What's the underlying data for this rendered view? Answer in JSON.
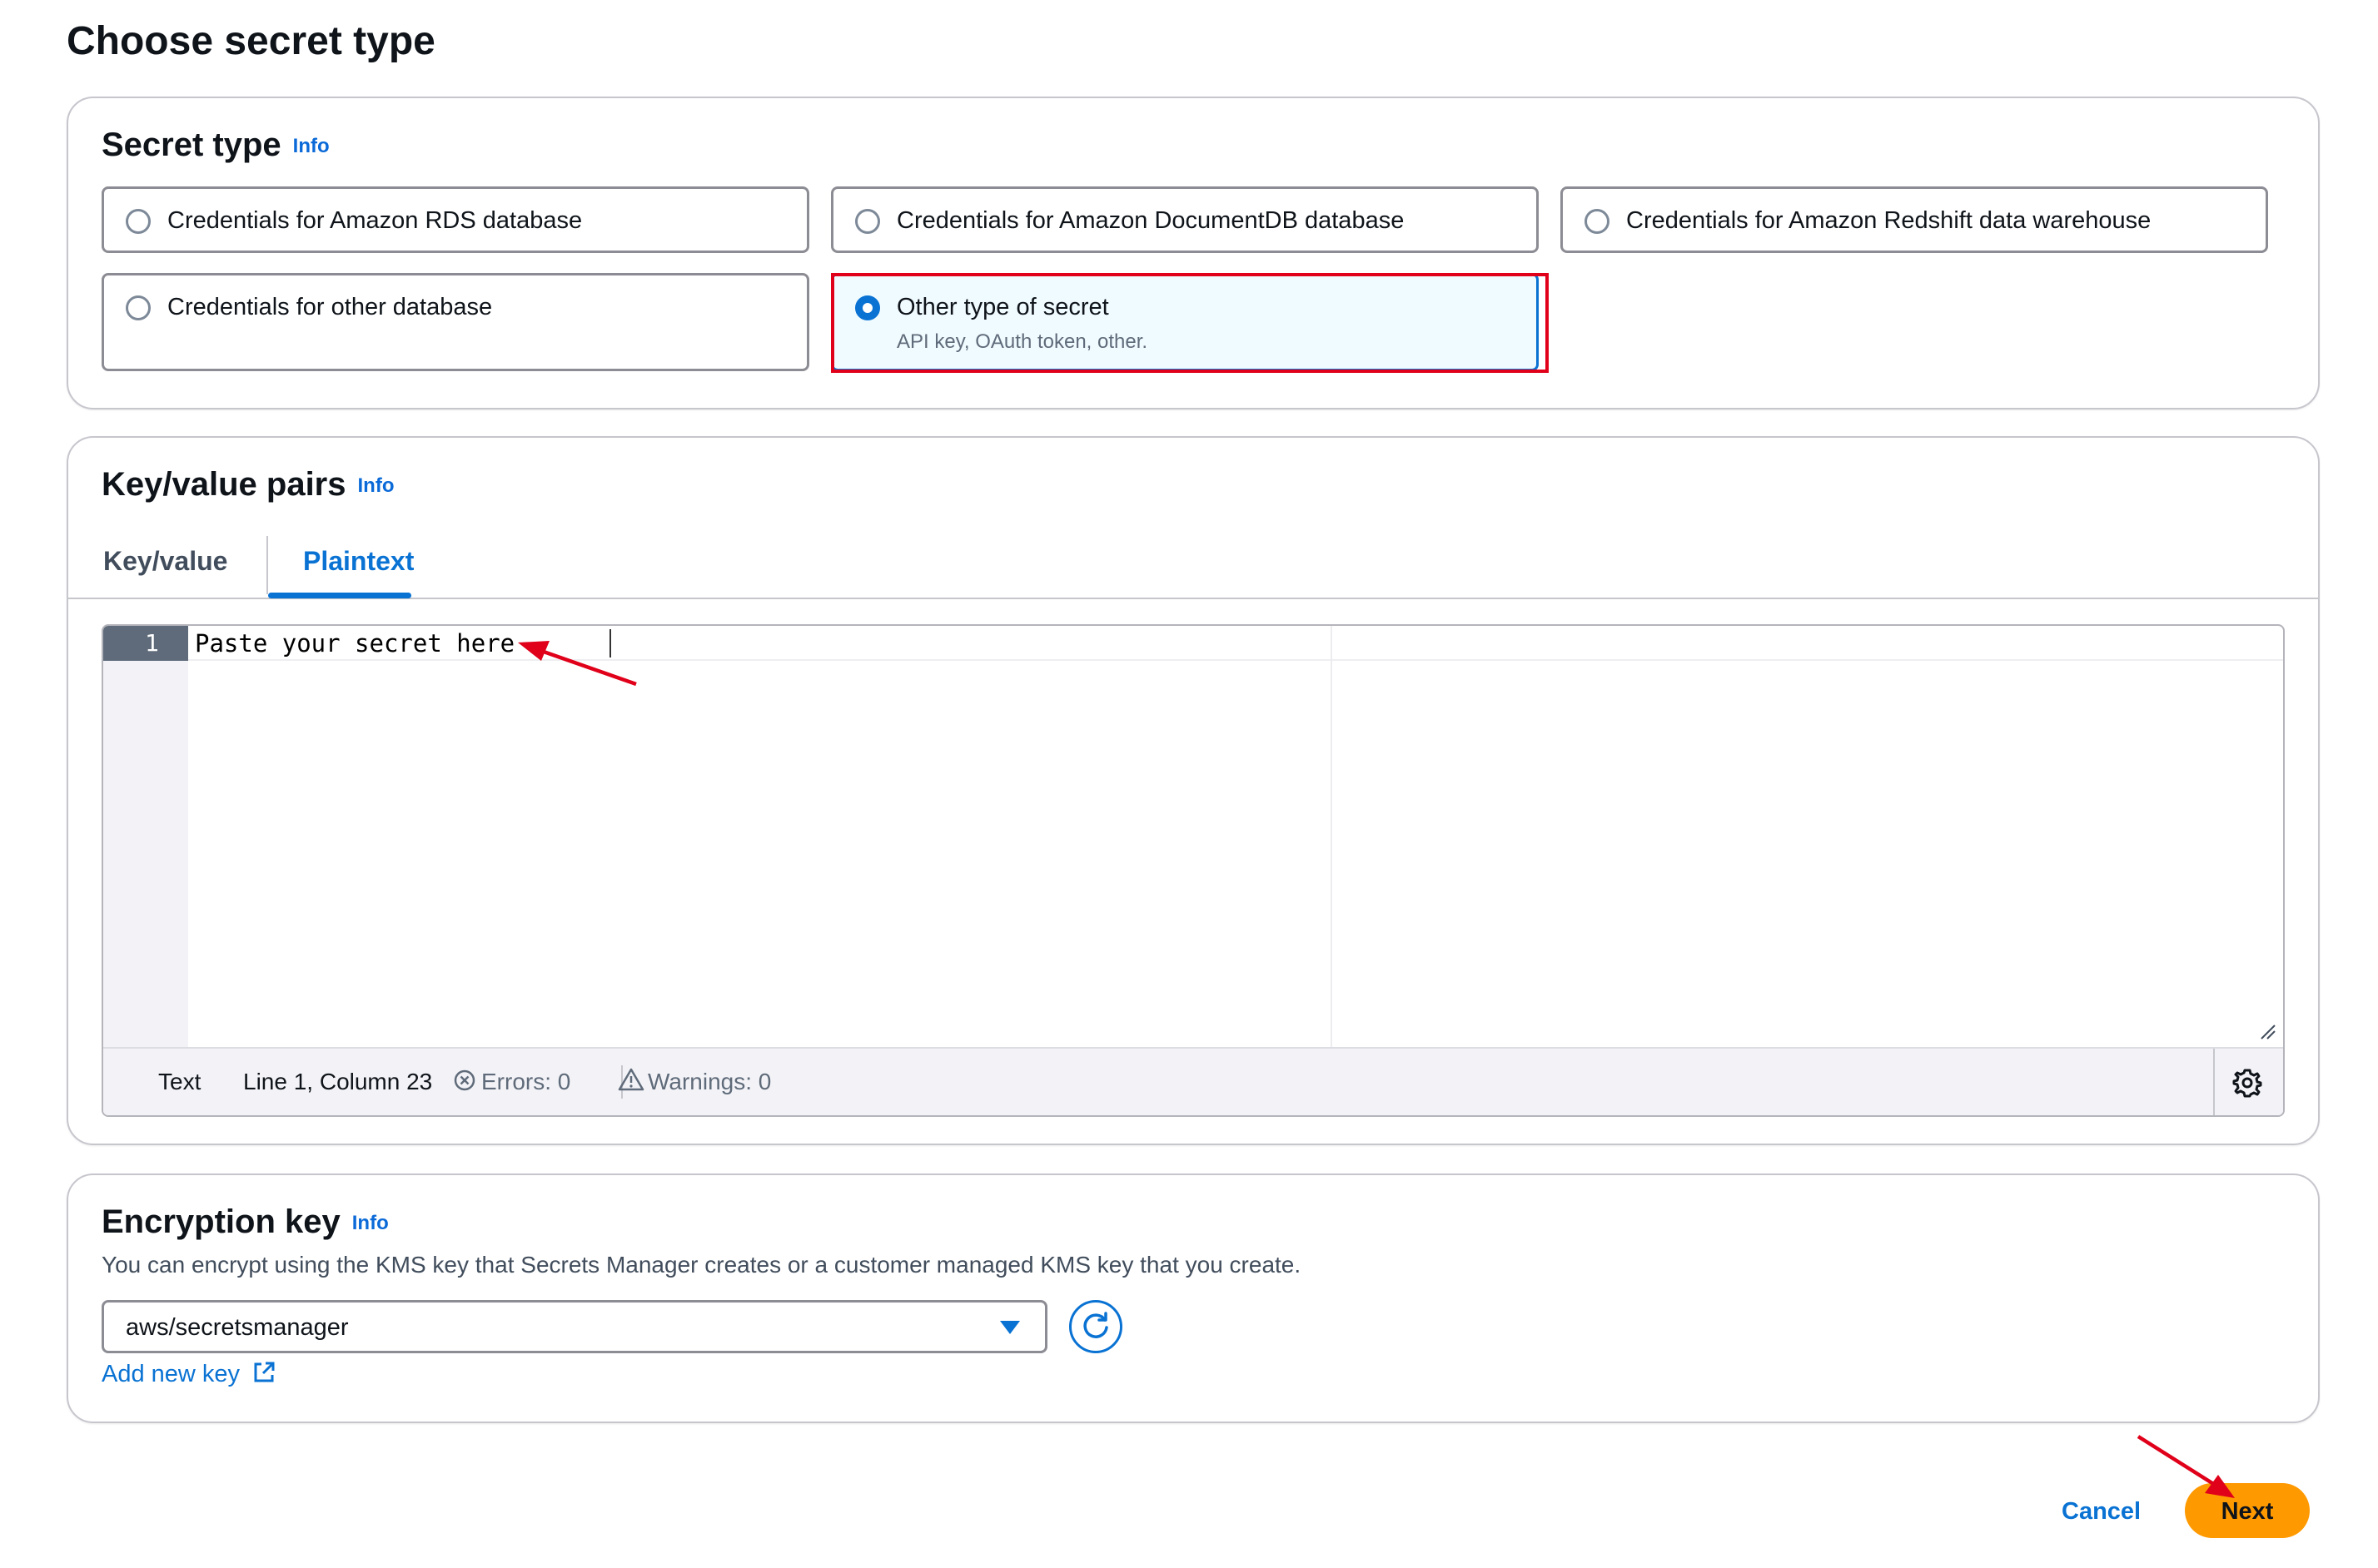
{
  "page": {
    "title": "Choose secret type"
  },
  "secret_type": {
    "title": "Secret type",
    "info": "Info",
    "options": [
      {
        "label": "Credentials for Amazon RDS database",
        "description": "",
        "selected": false
      },
      {
        "label": "Credentials for Amazon DocumentDB database",
        "description": "",
        "selected": false
      },
      {
        "label": "Credentials for Amazon Redshift data warehouse",
        "description": "",
        "selected": false
      },
      {
        "label": "Credentials for other database",
        "description": "",
        "selected": false
      },
      {
        "label": "Other type of secret",
        "description": "API key, OAuth token, other.",
        "selected": true
      }
    ]
  },
  "kv": {
    "title": "Key/value pairs",
    "info": "Info",
    "tabs": [
      {
        "label": "Key/value",
        "active": false
      },
      {
        "label": "Plaintext",
        "active": true
      }
    ],
    "editor": {
      "line_number": "1",
      "content": "Paste your secret here",
      "status": {
        "mode": "Text",
        "position": "Line 1, Column 23",
        "errors": "Errors: 0",
        "warnings": "Warnings: 0"
      }
    }
  },
  "encryption": {
    "title": "Encryption key",
    "info": "Info",
    "description": "You can encrypt using the KMS key that Secrets Manager creates or a customer managed KMS key that you create.",
    "selected_key": "aws/secretsmanager",
    "add_key_label": "Add new key"
  },
  "actions": {
    "cancel": "Cancel",
    "next": "Next"
  },
  "colors": {
    "accent": "#0972d3",
    "primary_button": "#ff9900",
    "annotation": "#e0001a"
  },
  "icons": [
    "info-link",
    "radio",
    "error-circle-icon",
    "warning-triangle-icon",
    "gear-icon",
    "refresh-icon",
    "external-link-icon",
    "chevron-down-icon",
    "resize-grip-icon"
  ]
}
